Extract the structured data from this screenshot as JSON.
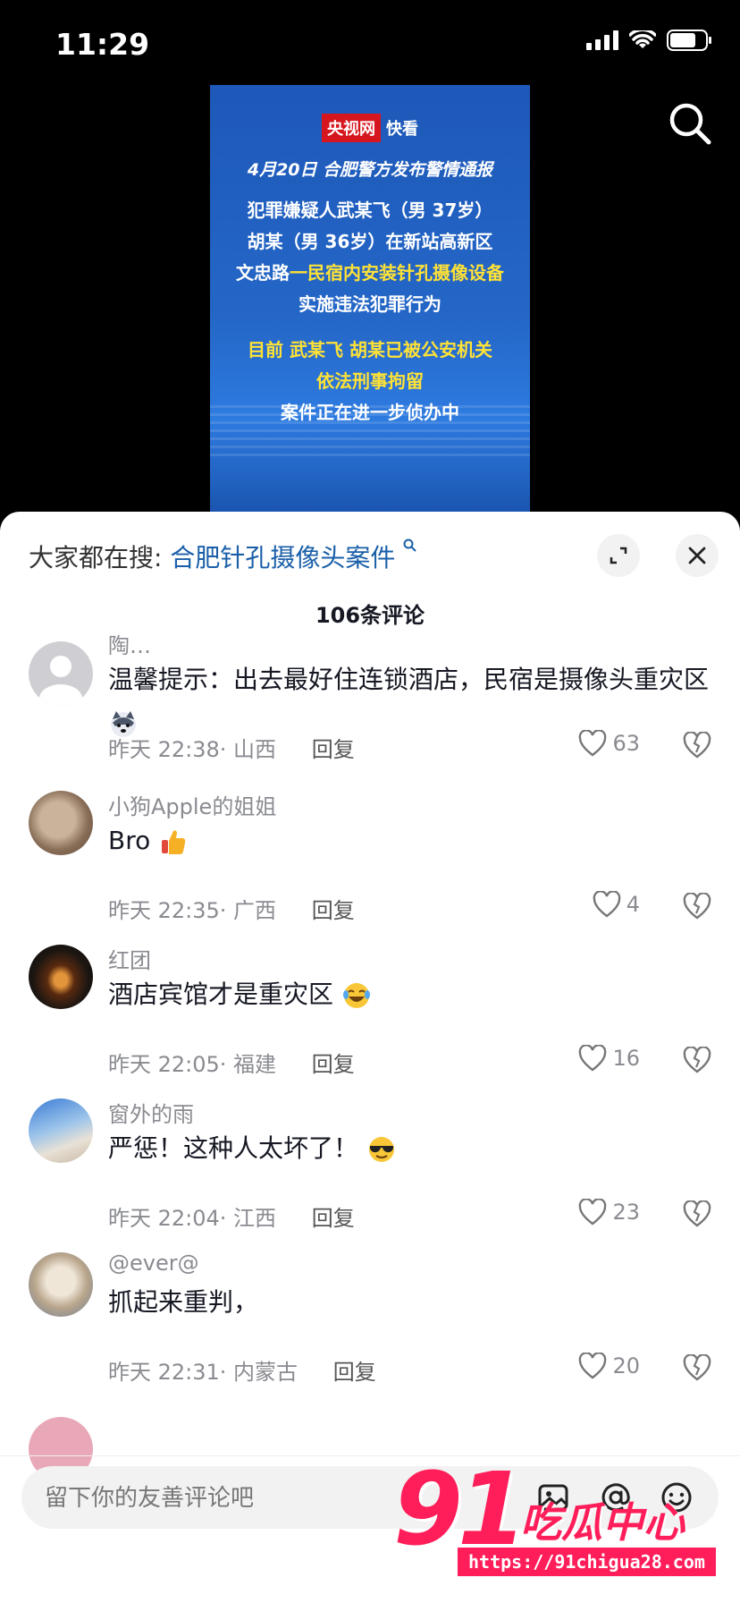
{
  "status_bar": {
    "time": "11:29"
  },
  "video": {
    "brand_red": "央视网",
    "brand_suffix": "快看",
    "subtitle": "4月20日 合肥警方发布警情通报",
    "line1": "犯罪嫌疑人武某飞（男 37岁）",
    "line2": "胡某（男 36岁）在新站高新区",
    "line3_white": "文忠路",
    "line3_yellow": "一民宿内安装针孔摄像设备",
    "line4": "实施违法犯罪行为",
    "line5": "目前 武某飞 胡某已被公安机关",
    "line6": "依法刑事拘留",
    "line7": "案件正在进一步侦办中"
  },
  "sheet": {
    "suggest_prefix": "大家都在搜:",
    "suggest_query": "合肥针孔摄像头案件",
    "comment_count": "106条评论"
  },
  "comments": [
    {
      "user": "陶…",
      "text": "温馨提示：出去最好住连锁酒店，民宿是摄像头重灾区",
      "emoji": "husky",
      "time": "昨天 22:38",
      "region": "· 山西",
      "reply": "回复",
      "likes": "63"
    },
    {
      "user": "小狗Apple的姐姐",
      "text": "Bro",
      "emoji": "thumbs-up",
      "time": "昨天 22:35",
      "region": "· 广西",
      "reply": "回复",
      "likes": "4"
    },
    {
      "user": "红团",
      "text": "酒店宾馆才是重灾区",
      "emoji": "laugh-cry",
      "time": "昨天 22:05",
      "region": "· 福建",
      "reply": "回复",
      "likes": "16"
    },
    {
      "user": "窗外的雨",
      "text": "严惩！这种人太坏了！",
      "emoji": "sunglasses",
      "time": "昨天 22:04",
      "region": "· 江西",
      "reply": "回复",
      "likes": "23"
    },
    {
      "user": "@ever@",
      "text": "抓起来重判，",
      "emoji": "",
      "time": "昨天 22:31",
      "region": "· 内蒙古",
      "reply": "回复",
      "likes": "20"
    }
  ],
  "input": {
    "placeholder": "留下你的友善评论吧"
  },
  "watermark": {
    "num": "91",
    "cn": "吃瓜中心",
    "url": "https://91chigua28.com"
  }
}
